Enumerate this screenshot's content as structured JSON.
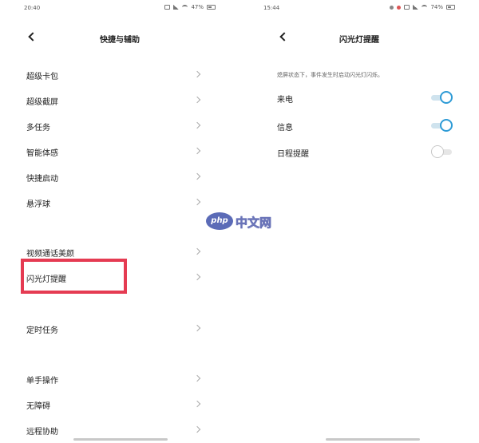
{
  "left_screen": {
    "status": {
      "time": "20:40",
      "battery": "47%"
    },
    "header": {
      "title": "快捷与辅助"
    },
    "items": [
      {
        "label": "超级卡包"
      },
      {
        "label": "超级截屏"
      },
      {
        "label": "多任务"
      },
      {
        "label": "智能体感"
      },
      {
        "label": "快捷启动"
      },
      {
        "label": "悬浮球"
      },
      {
        "label": "视频通话美颜"
      },
      {
        "label": "闪光灯提醒",
        "highlighted": true
      },
      {
        "label": "定时任务"
      },
      {
        "label": "单手操作"
      },
      {
        "label": "无障碍"
      },
      {
        "label": "远程协助"
      }
    ],
    "highlight_color": "#e53b52"
  },
  "right_screen": {
    "status": {
      "time": "15:44",
      "battery": "74%"
    },
    "header": {
      "title": "闪光灯提醒"
    },
    "note": "熄屏状态下，事件发生时启动闪光灯闪烁。",
    "settings": [
      {
        "label": "来电",
        "enabled": true
      },
      {
        "label": "信息",
        "enabled": true
      },
      {
        "label": "日程提醒",
        "enabled": false
      }
    ],
    "accent_color": "#2e9bd6"
  },
  "watermark": {
    "logo": "php",
    "text": "中文网"
  },
  "icons": [
    "back-arrow-icon",
    "chevron-right-icon",
    "toggle-switch"
  ]
}
